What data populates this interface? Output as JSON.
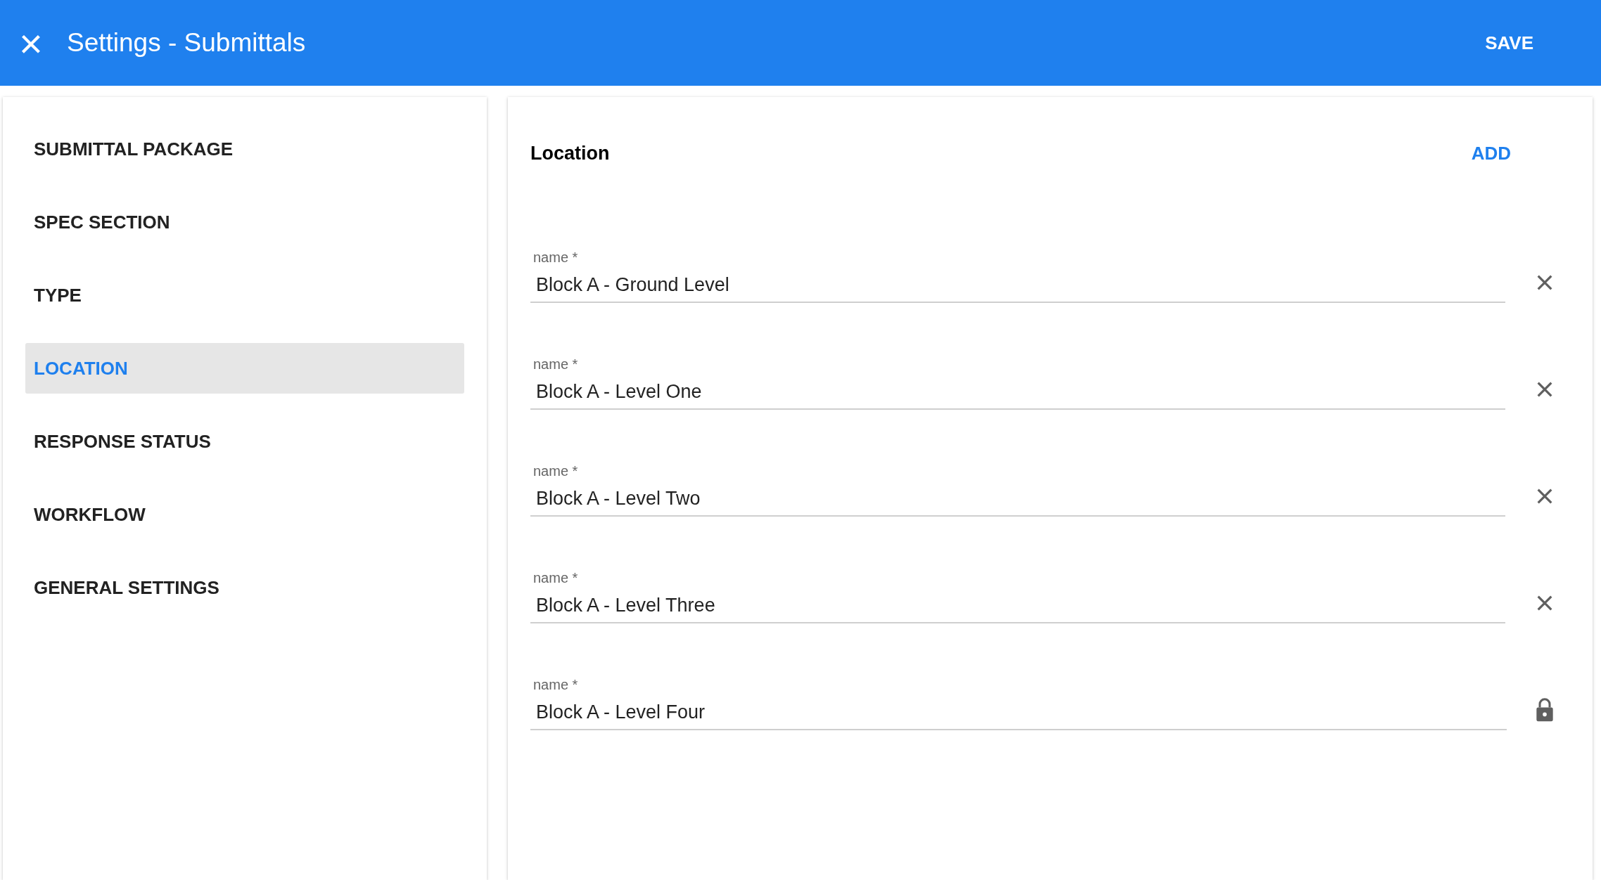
{
  "header": {
    "close_icon": "×",
    "title": "Settings - Submittals",
    "save": "SAVE"
  },
  "sidebar": {
    "items": [
      {
        "label": "SUBMITTAL PACKAGE",
        "selected": false
      },
      {
        "label": "SPEC SECTION",
        "selected": false
      },
      {
        "label": "TYPE",
        "selected": false
      },
      {
        "label": "LOCATION",
        "selected": true
      },
      {
        "label": "RESPONSE STATUS",
        "selected": false
      },
      {
        "label": "WORKFLOW",
        "selected": false
      },
      {
        "label": "GENERAL SETTINGS",
        "selected": false
      }
    ]
  },
  "panel": {
    "title": "Location",
    "add": "ADD",
    "fields": [
      {
        "label": "name *",
        "value": "Block A - Ground Level",
        "kind": "removable"
      },
      {
        "label": "name *",
        "value": "Block A - Level One",
        "kind": "removable"
      },
      {
        "label": "name *",
        "value": "Block A - Level Two",
        "kind": "removable"
      },
      {
        "label": "name *",
        "value": "Block A - Level Three",
        "kind": "removable"
      },
      {
        "label": "name *",
        "value": "Block A - Level Four",
        "kind": "locked"
      }
    ]
  }
}
